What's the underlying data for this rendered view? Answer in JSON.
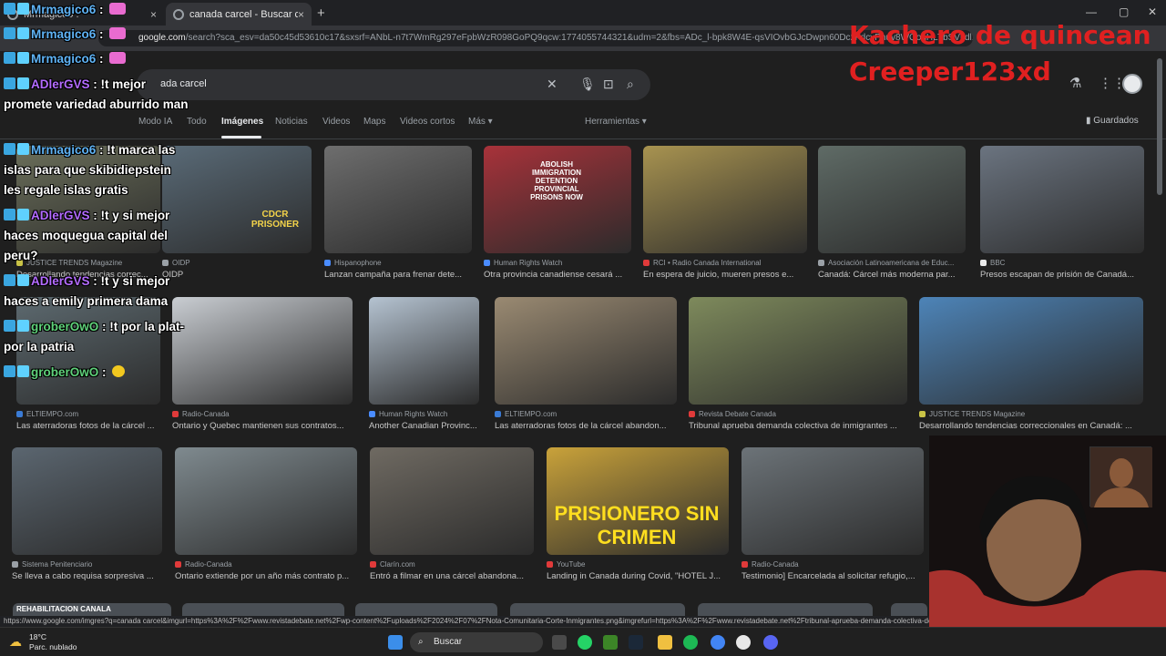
{
  "browser": {
    "tab1_title": "Mrmagico6 :",
    "tab2_title": "canada carcel - Buscar con Goo",
    "new_tab": "+",
    "tab_close": "×",
    "address": {
      "host": "google.com",
      "path": "/search?sca_esv=da50c45d53610c17&sxsrf=ANbL-n7t7WmRg297eFpbWzR098GoPQ9qcw:1774055744321&udm=2&fbs=ADc_l-bpk8W4E-qsVIOvbGJcDwpn60DczFdcvPnuv8WQohHLTbSVkdl...ldlqNg=en.OWna9..."
    },
    "status_url": "https://www.google.com/imgres?q=canada carcel&imgurl=https%3A%2F%2Fwww.revistadebate.net%2Fwp-content%2Fuploads%2F2024%2F07%2FNota-Comunitaria-Corte-Inmigrantes.png&imgrefurl=https%3A%2F%2Fwww.revistadebate.net%2Ftribunal-aprueba-demanda-colectiva-de-"
  },
  "google": {
    "query": "ada carcel",
    "nav_tabs": [
      "Modo IA",
      "Todo",
      "Imágenes",
      "Noticias",
      "Videos",
      "Maps",
      "Videos cortos",
      "Más ▾"
    ],
    "active_tab": "Imágenes",
    "tools": "Herramientas ▾",
    "saved": "Guardados"
  },
  "results": [
    {
      "source": "JUSTICE TRENDS Magazine",
      "caption": "Desarrollando tendencias correc...",
      "color": "#6b6f5a",
      "fav": "#c9c346"
    },
    {
      "source": "OIDP",
      "caption": "OIDP",
      "color": "#5a6b78",
      "fav": "#9aa0a6"
    },
    {
      "source": "Hispanophone",
      "caption": "Lanzan campaña para frenar dete...",
      "color": "#6e6e6e",
      "fav": "#4a8cff"
    },
    {
      "source": "Human Rights Watch",
      "caption": "Otra provincia canadiense cesará ...",
      "color": "#a8323a",
      "fav": "#4a8cff"
    },
    {
      "source": "RCI • Radio Canada International",
      "caption": "En espera de juicio, mueren presos e...",
      "color": "#a89350",
      "fav": "#e03a3a"
    },
    {
      "source": "Asociación Latinoamericana de Educ...",
      "caption": "Canadá: Cárcel más moderna par...",
      "color": "#5f6b66",
      "fav": "#9aa0a6"
    },
    {
      "source": "BBC",
      "caption": "Presos escapan de prisión de Canadá...",
      "color": "#6b7480",
      "fav": "#e8e8e8"
    },
    {
      "source": "ELTIEMPO.com",
      "caption": "Las aterradoras fotos de la cárcel ...",
      "color": "#5d6a70",
      "fav": "#3a7bd5"
    },
    {
      "source": "Radio-Canada",
      "caption": "Ontario y Quebec mantienen sus contratos...",
      "color": "#c9cdd2",
      "fav": "#e03a3a"
    },
    {
      "source": "Human Rights Watch",
      "caption": "Another Canadian Provinc...",
      "color": "#b5c3d1",
      "fav": "#4a8cff"
    },
    {
      "source": "ELTIEMPO.com",
      "caption": "Las aterradoras fotos de la cárcel abandon...",
      "color": "#9a8a72",
      "fav": "#3a7bd5"
    },
    {
      "source": "Revista Debate Canada",
      "caption": "Tribunal aprueba demanda colectiva de inmigrantes ...",
      "color": "#7e8a5c",
      "fav": "#e03a3a"
    },
    {
      "source": "JUSTICE TRENDS Magazine",
      "caption": "Desarrollando tendencias correccionales en Canadá: ...",
      "color": "#4d84b8",
      "fav": "#c9c346"
    },
    {
      "source": "Sistema Penitenciario",
      "caption": "Se lleva a cabo requisa sorpresiva ...",
      "color": "#5b6670",
      "fav": "#9aa0a6"
    },
    {
      "source": "Radio-Canada",
      "caption": "Ontario extiende por un año más contrato p...",
      "color": "#7f8a8f",
      "fav": "#e03a3a"
    },
    {
      "source": "Clarín.com",
      "caption": "Entró a filmar en una cárcel abandona...",
      "color": "#6f6a62",
      "fav": "#e03a3a"
    },
    {
      "source": "YouTube",
      "caption": "Landing in Canada during Covid, \"HOTEL J...",
      "color": "#c9a23a",
      "fav": "#e03a3a"
    },
    {
      "source": "Radio-Canada",
      "caption": "Testimonio] Encarcelada al solicitar refugio,...",
      "color": "#6c7378",
      "fav": "#e03a3a"
    }
  ],
  "thumb_texts": {
    "cdcr": "CDCR PRISONER",
    "protest": "ABOLISH IMMIGRATION DETENTION PROVINCIAL PRISONS NOW",
    "prisionero": "PRISIONERO SIN CRIMEN",
    "rehab": "REHABILITACION CANALA"
  },
  "chat": [
    {
      "user": "Mrmagico6",
      "color": "#5fb3f5",
      "message": ":"
    },
    {
      "user": "Mrmagico6",
      "color": "#5fb3f5",
      "message": ":"
    },
    {
      "user": "Mrmagico6",
      "color": "#5fb3f5",
      "message": ":"
    },
    {
      "user": "ADlerGVS",
      "color": "#b36bff",
      "message": ": !t mejor promete variedad aburrido man"
    },
    {
      "user": "Mrmagico6",
      "color": "#5fb3f5",
      "message": ": !t marca las islas para que skibidiepstein les regale islas gratis"
    },
    {
      "user": "ADlerGVS",
      "color": "#b36bff",
      "message": ": !t y si mejor haces moquegua capital del peru?"
    },
    {
      "user": "ADlerGVS",
      "color": "#b36bff",
      "message": ": !t y si mejor haces a emily primera dama"
    },
    {
      "user": "groberOwO",
      "color": "#5fd17a",
      "message": ": !t por la plat- por la patria"
    },
    {
      "user": "groberOwO",
      "color": "#5fd17a",
      "message": ":"
    }
  ],
  "watermark": [
    "Kachero de quincean",
    "Creeper123xd"
  ],
  "taskbar": {
    "temp": "18°C",
    "weather": "Parc. nublado",
    "search": "Buscar"
  }
}
